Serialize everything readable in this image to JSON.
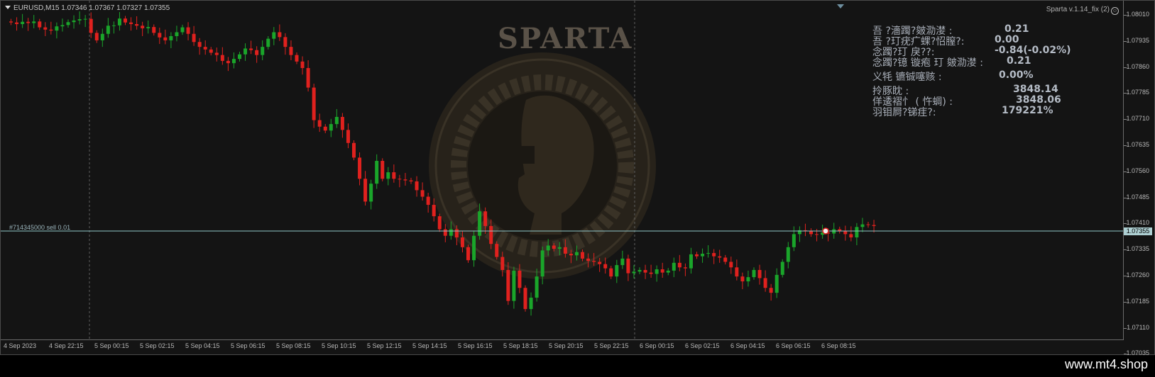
{
  "symbol_header": "EURUSD,M15  1.07346 1.07367 1.07327 1.07355",
  "indicator_label": "Sparta v.1.14_fix (2)",
  "order_label": "#714345000 sell 0.01",
  "watermark_title": "SPARTA",
  "current_price": "1.07355",
  "stats": [
    {
      "label": "吾   ?濇躅?皴泐漤     :",
      "value": "0.21",
      "vx": 186
    },
    {
      "label": "吾   ?玎疣疒蜾?怊膣?:",
      "value": "0.00",
      "vx": 172
    },
    {
      "label": "念躅?玎 戾??:",
      "value": "-0.84(-0.02%)",
      "vx": 172
    },
    {
      "label": "念躅?镱 镟疱 玎 皴泐漤    :",
      "value": "0.21",
      "vx": 189
    },
    {
      "label": "义牦         镳铖噻赅 :",
      "value": "0.00%",
      "vx": 178,
      "gap": true
    },
    {
      "label": "拎豚眈 :",
      "value": "3848.14",
      "vx": 198,
      "gap": true
    },
    {
      "label": "佯逶褶忄  (    忤蜩) :",
      "value": "3848.06",
      "vx": 202
    },
    {
      "label": "羽钼屙?锑疰?:",
      "value": "179221%",
      "vx": 182
    }
  ],
  "price_axis": [
    "1.08010",
    "1.07935",
    "1.07860",
    "1.07785",
    "1.07710",
    "1.07635",
    "1.07560",
    "1.07485",
    "1.07410",
    "1.07335",
    "1.07260",
    "1.07185",
    "1.07110",
    "1.07035"
  ],
  "time_axis": [
    "4 Sep 2023",
    "4 Sep 22:15",
    "5 Sep 00:15",
    "5 Sep 02:15",
    "5 Sep 04:15",
    "5 Sep 06:15",
    "5 Sep 08:15",
    "5 Sep 10:15",
    "5 Sep 12:15",
    "5 Sep 14:15",
    "5 Sep 16:15",
    "5 Sep 18:15",
    "5 Sep 20:15",
    "5 Sep 22:15",
    "6 Sep 00:15",
    "6 Sep 02:15",
    "6 Sep 04:15",
    "6 Sep 06:15",
    "6 Sep 08:15"
  ],
  "footer": "www.mt4.shop",
  "chart_data": {
    "type": "candlestick",
    "ylim": [
      1.07035,
      1.08025
    ],
    "colors": {
      "up": "#1aa52a",
      "down": "#e0211e",
      "background": "#141414",
      "bid_line": "#8fc7c9"
    },
    "closes": [
      1.0798,
      1.07975,
      1.07982,
      1.07978,
      1.07983,
      1.07965,
      1.07958,
      1.07955,
      1.07968,
      1.07972,
      1.07981,
      1.07986,
      1.0799,
      1.07991,
      1.07948,
      1.07925,
      1.07945,
      1.0797,
      1.07971,
      1.07992,
      1.0798,
      1.07975,
      1.0797,
      1.07962,
      1.07966,
      1.07948,
      1.07934,
      1.07925,
      1.07938,
      1.0795,
      1.07965,
      1.07945,
      1.0792,
      1.07905,
      1.07897,
      1.07887,
      1.0788,
      1.07862,
      1.07855,
      1.07868,
      1.07882,
      1.079,
      1.07895,
      1.0788,
      1.07905,
      1.0793,
      1.0795,
      1.07935,
      1.07905,
      1.0788,
      1.0786,
      1.0784,
      1.0778,
      1.0768,
      1.0766,
      1.07648,
      1.07668,
      1.0769,
      1.0765,
      1.0761,
      1.07565,
      1.075,
      1.0743,
      1.07485,
      1.07555,
      1.075,
      1.0752,
      1.075,
      1.07498,
      1.07495,
      1.07492,
      1.07465,
      1.07445,
      1.0742,
      1.07385,
      1.07345,
      1.07325,
      1.07345,
      1.0732,
      1.0729,
      1.0725,
      1.07325,
      1.074,
      1.07355,
      1.073,
      1.0726,
      1.0722,
      1.07125,
      1.07218,
      1.07165,
      1.071,
      1.07135,
      1.072,
      1.0728,
      1.07295,
      1.07285,
      1.0729,
      1.0727,
      1.07265,
      1.07275,
      1.07255,
      1.07248,
      1.07245,
      1.07238,
      1.07225,
      1.072,
      1.07235,
      1.07255,
      1.0721,
      1.07215,
      1.0722,
      1.07212,
      1.07208,
      1.07222,
      1.07212,
      1.07218,
      1.07242,
      1.07228,
      1.07225,
      1.07268,
      1.07262,
      1.0727,
      1.07272,
      1.07262,
      1.07258,
      1.07245,
      1.07228,
      1.072,
      1.07185,
      1.07198,
      1.0722,
      1.07195,
      1.07165,
      1.0715,
      1.07205,
      1.07245,
      1.0729,
      1.0733,
      1.07342,
      1.0734,
      1.0733,
      1.07328,
      1.07335,
      1.07332,
      1.07345,
      1.0734,
      1.0733,
      1.0732,
      1.07352,
      1.0736,
      1.07358,
      1.07355
    ]
  }
}
